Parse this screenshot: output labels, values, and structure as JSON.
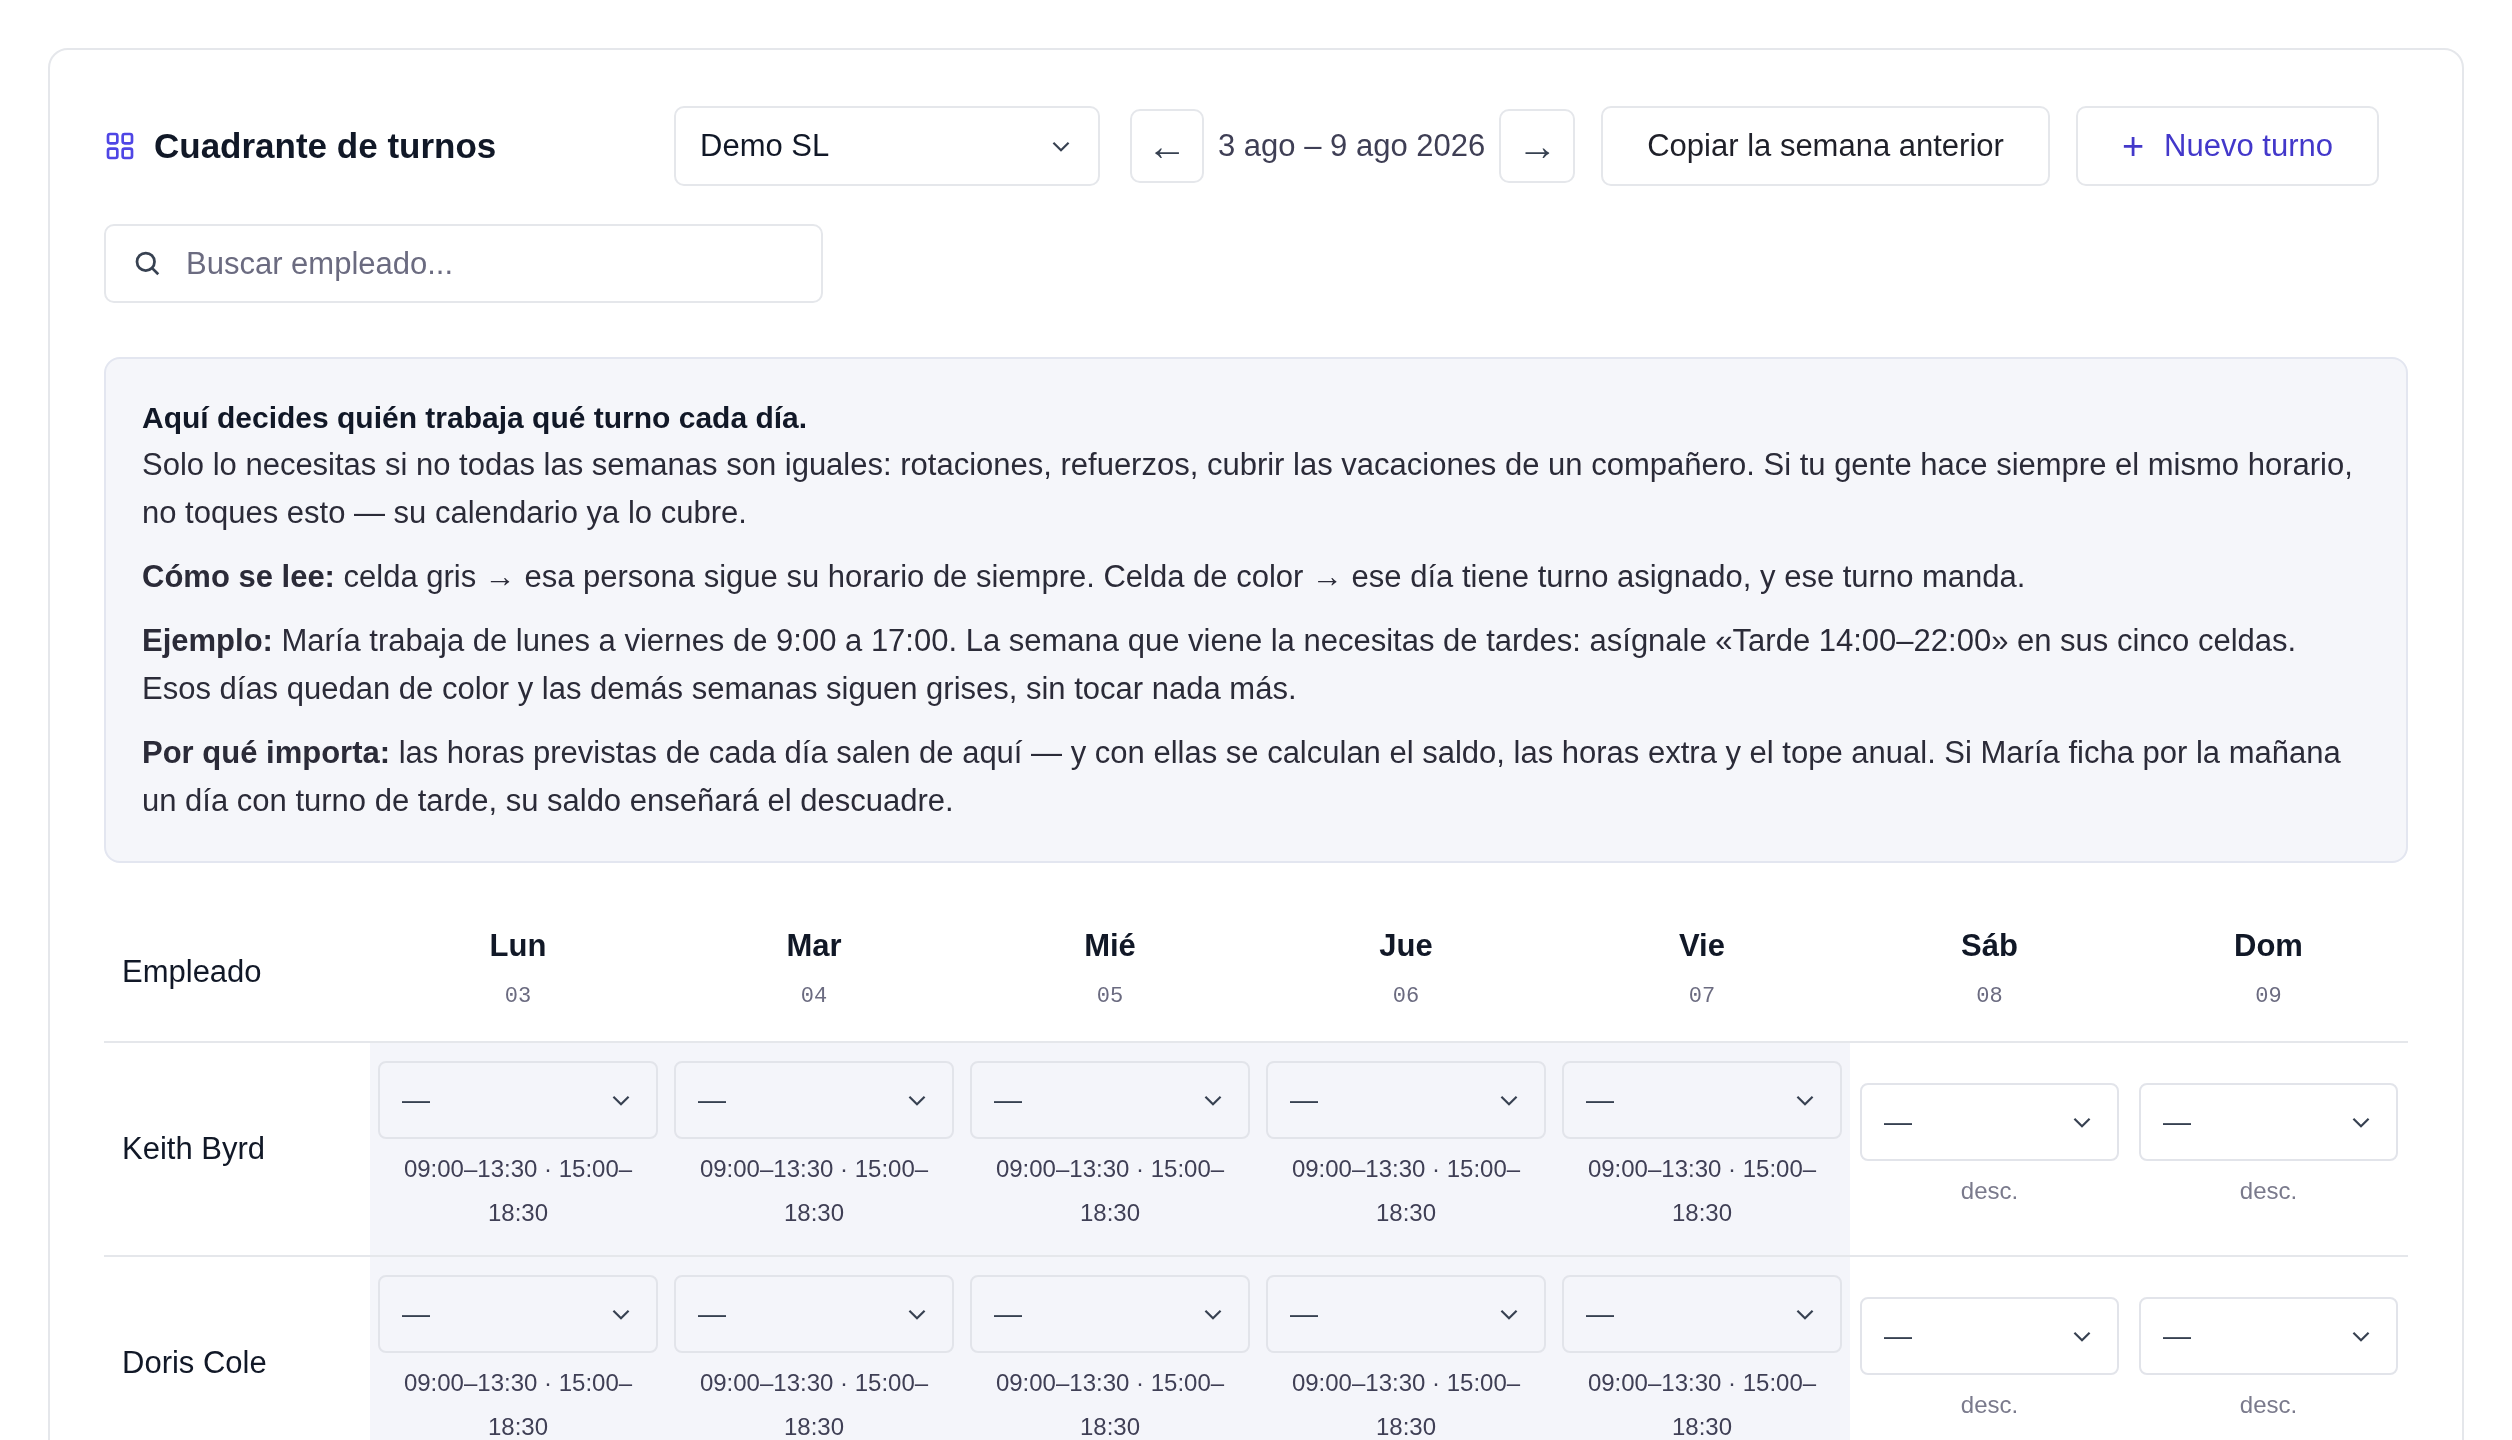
{
  "header": {
    "title": "Cuadrante de turnos",
    "company_select": {
      "value": "Demo SL"
    },
    "prev_button": "←",
    "date_range": "3 ago – 9 ago 2026",
    "next_button": "→",
    "copy_button": "Copiar la semana anterior",
    "new_button": {
      "icon": "+",
      "label": "Nuevo turno"
    }
  },
  "search": {
    "placeholder": "Buscar empleado..."
  },
  "info": {
    "heading": "Aquí decides quién trabaja qué turno cada día.",
    "paragraphs": [
      "Solo lo necesitas si no todas las semanas son iguales: rotaciones, refuerzos, cubrir las vacaciones de un compañero. Si tu gente hace siempre el mismo horario, no toques esto — su calendario ya lo cubre.",
      "**Cómo se lee:** celda gris → esa persona sigue su horario de siempre. Celda de color → ese día tiene turno asignado, y ese turno manda.",
      "**Ejemplo:** María trabaja de lunes a viernes de 9:00 a 17:00. La semana que viene la necesitas de tardes: asígnale «Tarde 14:00–22:00» en sus cinco celdas. Esos días quedan de color y las demás semanas siguen grises, sin tocar nada más.",
      "**Por qué importa:** las horas previstas de cada día salen de aquí — y con ellas se calculan el saldo, las horas extra y el tope anual. Si María ficha por la mañana un día con turno de tarde, su saldo enseñará el descuadre."
    ]
  },
  "table": {
    "first_column": "Empleado",
    "days": [
      {
        "label": "Lun",
        "number": "03"
      },
      {
        "label": "Mar",
        "number": "04"
      },
      {
        "label": "Mié",
        "number": "05"
      },
      {
        "label": "Jue",
        "number": "06"
      },
      {
        "label": "Vie",
        "number": "07"
      },
      {
        "label": "Sáb",
        "number": "08"
      },
      {
        "label": "Dom",
        "number": "09"
      }
    ],
    "rows": [
      {
        "employee": "Keith Byrd",
        "cells": [
          {
            "kind": "workday",
            "value": "—",
            "note": "09:00–13:30 · 15:00–18:30"
          },
          {
            "kind": "workday",
            "value": "—",
            "note": "09:00–13:30 · 15:00–18:30"
          },
          {
            "kind": "workday",
            "value": "—",
            "note": "09:00–13:30 · 15:00–18:30"
          },
          {
            "kind": "workday",
            "value": "—",
            "note": "09:00–13:30 · 15:00–18:30"
          },
          {
            "kind": "workday",
            "value": "—",
            "note": "09:00–13:30 · 15:00–18:30"
          },
          {
            "kind": "rest",
            "value": "—",
            "note": "desc."
          },
          {
            "kind": "rest",
            "value": "—",
            "note": "desc."
          }
        ]
      },
      {
        "employee": "Doris Cole",
        "cells": [
          {
            "kind": "workday",
            "value": "—",
            "note": "09:00–13:30 · 15:00–18:30"
          },
          {
            "kind": "workday",
            "value": "—",
            "note": "09:00–13:30 · 15:00–18:30"
          },
          {
            "kind": "workday",
            "value": "—",
            "note": "09:00–13:30 · 15:00–18:30"
          },
          {
            "kind": "workday",
            "value": "—",
            "note": "09:00–13:30 · 15:00–18:30"
          },
          {
            "kind": "workday",
            "value": "—",
            "note": "09:00–13:30 · 15:00–18:30"
          },
          {
            "kind": "rest",
            "value": "—",
            "note": "desc."
          },
          {
            "kind": "rest",
            "value": "—",
            "note": "desc."
          }
        ]
      }
    ]
  }
}
